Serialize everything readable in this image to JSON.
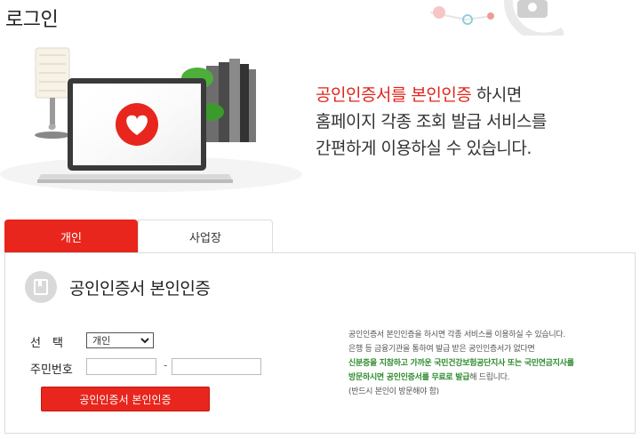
{
  "page": {
    "title": "로그인"
  },
  "hero": {
    "line1_highlight": "공인인증서를 본인인증",
    "line1_rest": " 하시면",
    "line2": "홈페이지 각종 조회 발급 서비스를",
    "line3": "간편하게 이용하실 수 있습니다."
  },
  "tabs": [
    {
      "label": "개인",
      "active": true
    },
    {
      "label": "사업장",
      "active": false
    }
  ],
  "section": {
    "title": "공인인증서 본인인증"
  },
  "form": {
    "select_label": "선　택",
    "select_value": "개인",
    "rrn_label": "주민번호",
    "rrn_front": "",
    "rrn_back": "",
    "rrn_separator": "-",
    "submit_label": "공인인증서 본인인증"
  },
  "notice": {
    "line1": "공인인증서 본인인증을 하시면 각종 서비스를 이용하실 수 있습니다.",
    "line2": "은행 등 금융기관을 통하여 발급 받은 공인인증서가 없다면",
    "line3_green": "신분증을 지참하고 가까운 국민건강보험공단지사 또는 국민연금지사를",
    "line4_green": "방문하시면 공인인증서를 무료로 발급",
    "line4_rest": "해 드립니다.",
    "line5": "(반드시 본인이 방문해야 함)"
  },
  "colors": {
    "accent": "#e8261d",
    "highlight_text": "#e2231a",
    "notice_green": "#2e8b2e"
  }
}
